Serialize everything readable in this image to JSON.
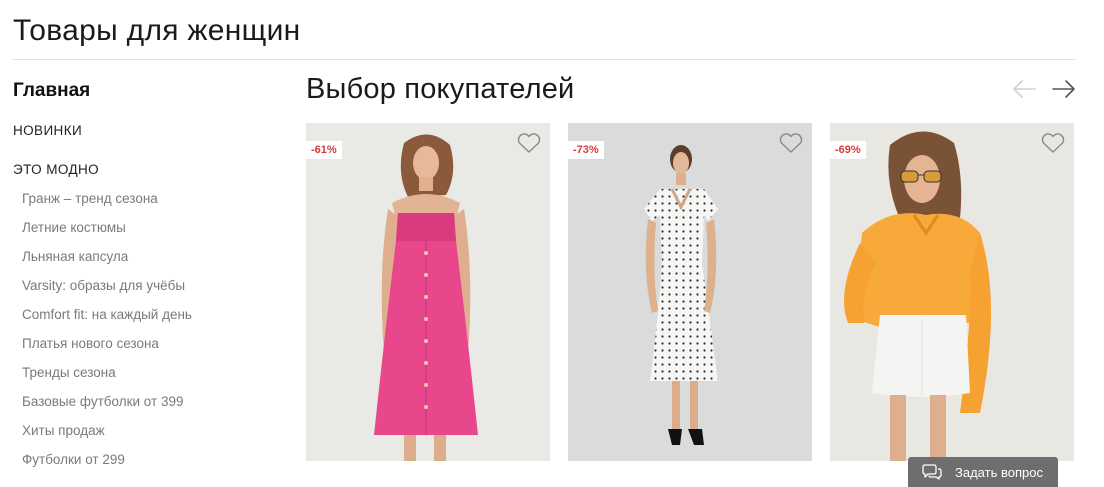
{
  "page": {
    "title": "Товары для женщин"
  },
  "sidebar": {
    "main_label": "Главная",
    "new_label": "новинки",
    "fashion_label": "это модно",
    "items": [
      "Гранж – тренд сезона",
      "Летние костюмы",
      "Льняная капсула",
      "Varsity: образы для учёбы",
      "Comfort fit: на каждый день",
      "Платья нового сезона",
      "Тренды сезона",
      "Базовые футболки от 399",
      "Хиты продаж",
      "Футболки от 299"
    ]
  },
  "section": {
    "title": "Выбор покупателей"
  },
  "products": [
    {
      "discount": "-61%",
      "image": "pink-button-front-dress"
    },
    {
      "discount": "-73%",
      "image": "white-polka-dot-dress"
    },
    {
      "discount": "-69%",
      "image": "orange-shirt-white-denim-skirt"
    }
  ],
  "icons": {
    "prev": "arrow-left-icon",
    "next": "arrow-right-icon",
    "favorite": "heart-icon",
    "chat": "chat-bubble-icon"
  },
  "colors": {
    "discount": "#d63b3b",
    "ask_button": "#6e6e6e"
  },
  "support": {
    "ask_label": "Задать вопрос"
  }
}
